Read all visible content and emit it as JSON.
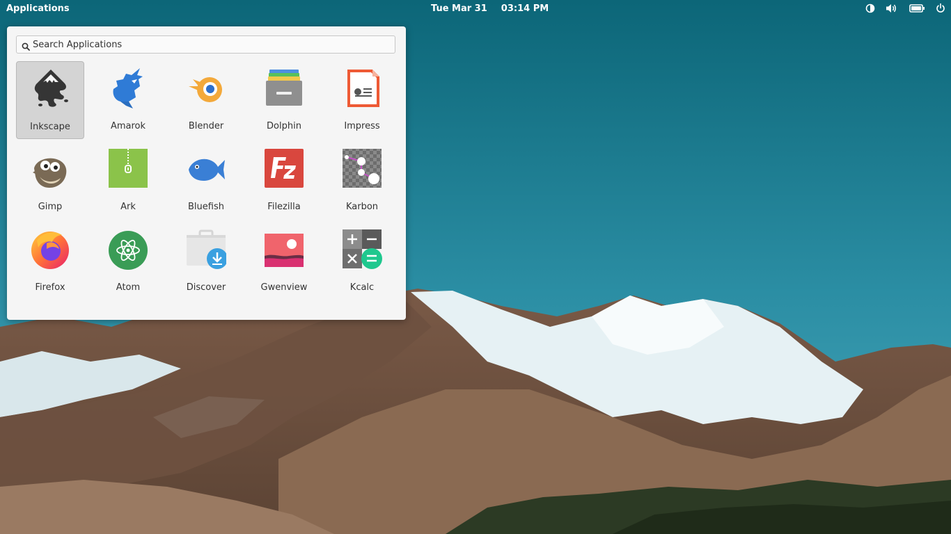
{
  "topbar": {
    "applications_label": "Applications",
    "date": "Tue Mar 31",
    "time": "03:14 PM",
    "indicators": [
      "contrast-icon",
      "volume-icon",
      "battery-icon",
      "power-icon"
    ]
  },
  "launcher": {
    "search_placeholder": "Search Applications",
    "search_value": "",
    "apps": [
      {
        "label": "Inkscape",
        "icon": "inkscape-icon",
        "selected": true
      },
      {
        "label": "Amarok",
        "icon": "amarok-icon"
      },
      {
        "label": "Blender",
        "icon": "blender-icon"
      },
      {
        "label": "Dolphin",
        "icon": "dolphin-icon"
      },
      {
        "label": "Impress",
        "icon": "impress-icon"
      },
      {
        "label": "Gimp",
        "icon": "gimp-icon"
      },
      {
        "label": "Ark",
        "icon": "ark-icon"
      },
      {
        "label": "Bluefish",
        "icon": "bluefish-icon"
      },
      {
        "label": "Filezilla",
        "icon": "filezilla-icon"
      },
      {
        "label": "Karbon",
        "icon": "karbon-icon"
      },
      {
        "label": "Firefox",
        "icon": "firefox-icon"
      },
      {
        "label": "Atom",
        "icon": "atom-icon"
      },
      {
        "label": "Discover",
        "icon": "discover-icon"
      },
      {
        "label": "Gwenview",
        "icon": "gwenview-icon"
      },
      {
        "label": "Kcalc",
        "icon": "kcalc-icon"
      }
    ]
  },
  "colors": {
    "sky_top": "#0f6f82",
    "sky_bottom": "#3ea1b6",
    "panel_bg": "#f5f5f5",
    "selected_bg": "#d4d4d4"
  }
}
